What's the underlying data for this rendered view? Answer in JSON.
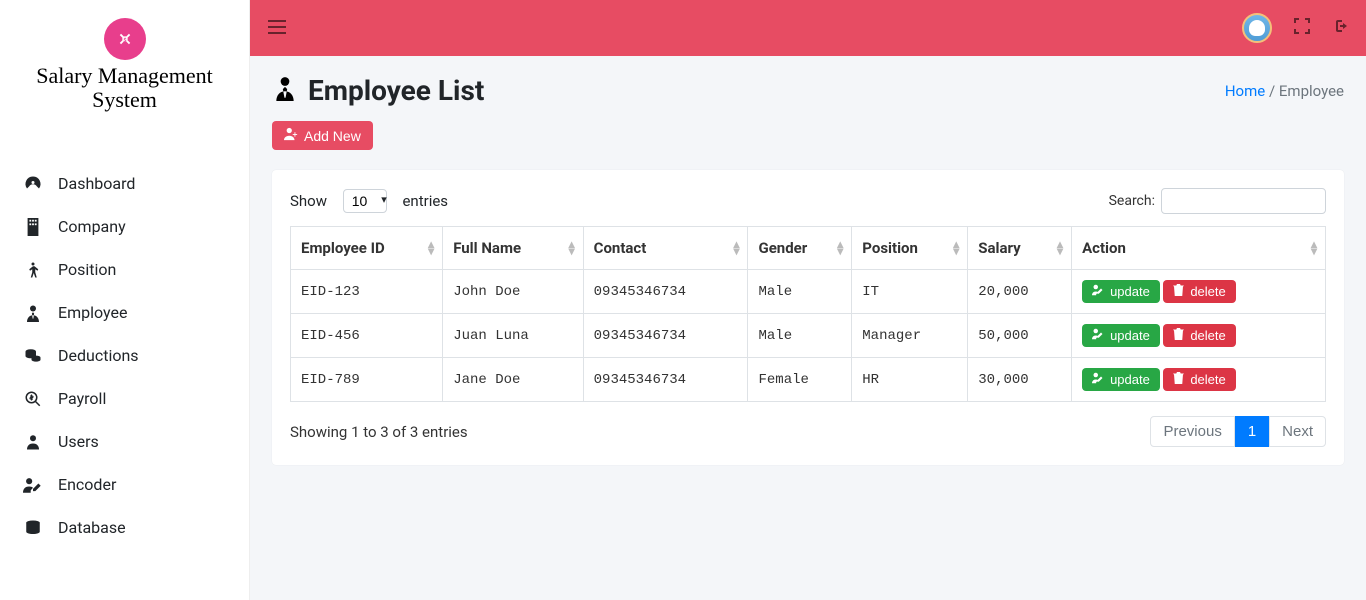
{
  "brand": {
    "line1": "Salary Management",
    "line2": "System"
  },
  "sidebar": {
    "items": [
      {
        "label": "Dashboard",
        "icon": "dashboard"
      },
      {
        "label": "Company",
        "icon": "building"
      },
      {
        "label": "Position",
        "icon": "child"
      },
      {
        "label": "Employee",
        "icon": "user-tie"
      },
      {
        "label": "Deductions",
        "icon": "coins"
      },
      {
        "label": "Payroll",
        "icon": "search-dollar"
      },
      {
        "label": "Users",
        "icon": "user"
      },
      {
        "label": "Encoder",
        "icon": "user-edit"
      },
      {
        "label": "Database",
        "icon": "database"
      }
    ]
  },
  "page": {
    "title": "Employee List",
    "breadcrumb_home": "Home",
    "breadcrumb_current": "Employee",
    "add_new_label": "Add New"
  },
  "table": {
    "show_label": "Show",
    "entries_label": "entries",
    "length_value": "10",
    "search_label": "Search:",
    "search_value": "",
    "columns": [
      "Employee ID",
      "Full Name",
      "Contact",
      "Gender",
      "Position",
      "Salary",
      "Action"
    ],
    "rows": [
      {
        "id": "EID-123",
        "name": "John Doe",
        "contact": "09345346734",
        "gender": "Male",
        "position": "IT",
        "salary": "20,000"
      },
      {
        "id": "EID-456",
        "name": "Juan Luna",
        "contact": "09345346734",
        "gender": "Male",
        "position": "Manager",
        "salary": "50,000"
      },
      {
        "id": "EID-789",
        "name": "Jane Doe",
        "contact": "09345346734",
        "gender": "Female",
        "position": "HR",
        "salary": "30,000"
      }
    ],
    "action_update": "update",
    "action_delete": "delete",
    "info": "Showing 1 to 3 of 3 entries",
    "prev": "Previous",
    "next": "Next",
    "current_page": "1"
  }
}
